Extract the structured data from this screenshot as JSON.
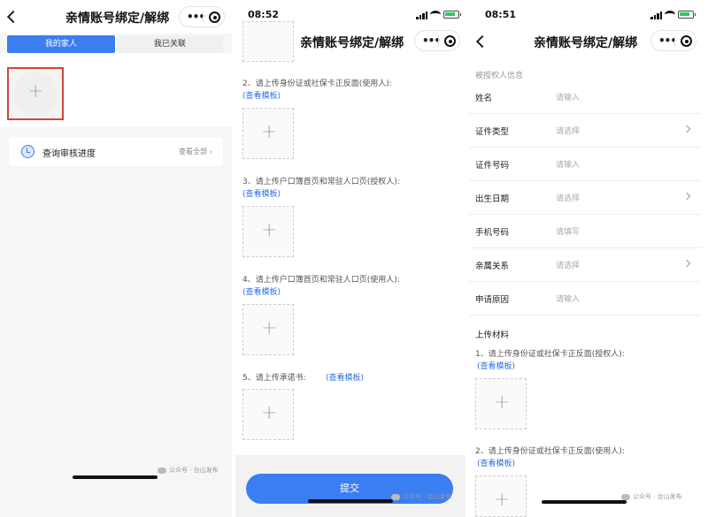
{
  "screen1": {
    "title": "亲情账号绑定/解绑",
    "tabs": [
      "我的家人",
      "我已关联"
    ],
    "add_symbol": "+",
    "progress_label": "查询审核进度",
    "view_all": "查看全部",
    "watermark": "公众号 · 台山发布"
  },
  "screen2": {
    "time": "08:52",
    "title": "亲情账号绑定/解绑",
    "uploads": [
      {
        "label": "2、请上传身份证或社保卡正反面(使用人):",
        "link": "(查看模板)"
      },
      {
        "label": "3、请上传户口簿首页和常驻人口页(授权人):",
        "link": "(查看模板)"
      },
      {
        "label": "4、请上传户口簿首页和常驻人口页(使用人):",
        "link": "(查看模板)"
      },
      {
        "label": "5、请上传承诺书:",
        "link": "(查看模板)"
      }
    ],
    "add_symbol": "+",
    "submit": "提交",
    "watermark": "公众号 · 台山发布"
  },
  "screen3": {
    "time": "08:51",
    "title": "亲情账号绑定/解绑",
    "section_title": "被授权人信息",
    "fields": [
      {
        "label": "姓名",
        "placeholder": "请输入"
      },
      {
        "label": "证件类型",
        "placeholder": "请选择"
      },
      {
        "label": "证件号码",
        "placeholder": "请输入"
      },
      {
        "label": "出生日期",
        "placeholder": "请选择"
      },
      {
        "label": "手机号码",
        "placeholder": "请填写"
      },
      {
        "label": "亲属关系",
        "placeholder": "请选择"
      },
      {
        "label": "申请原因",
        "placeholder": "请输入"
      }
    ],
    "materials_title": "上传材料",
    "uploads": [
      {
        "label": "1、请上传身份证或社保卡正反面(授权人):",
        "link": "(查看模板)"
      },
      {
        "label": "2、请上传身份证或社保卡正反面(使用人):",
        "link": "(查看模板)"
      }
    ],
    "add_symbol": "+",
    "watermark": "公众号 · 台山发布"
  },
  "colors": {
    "accent": "#3b7ef2",
    "link": "#2f6fe0",
    "highlight_border": "#d0463c"
  }
}
